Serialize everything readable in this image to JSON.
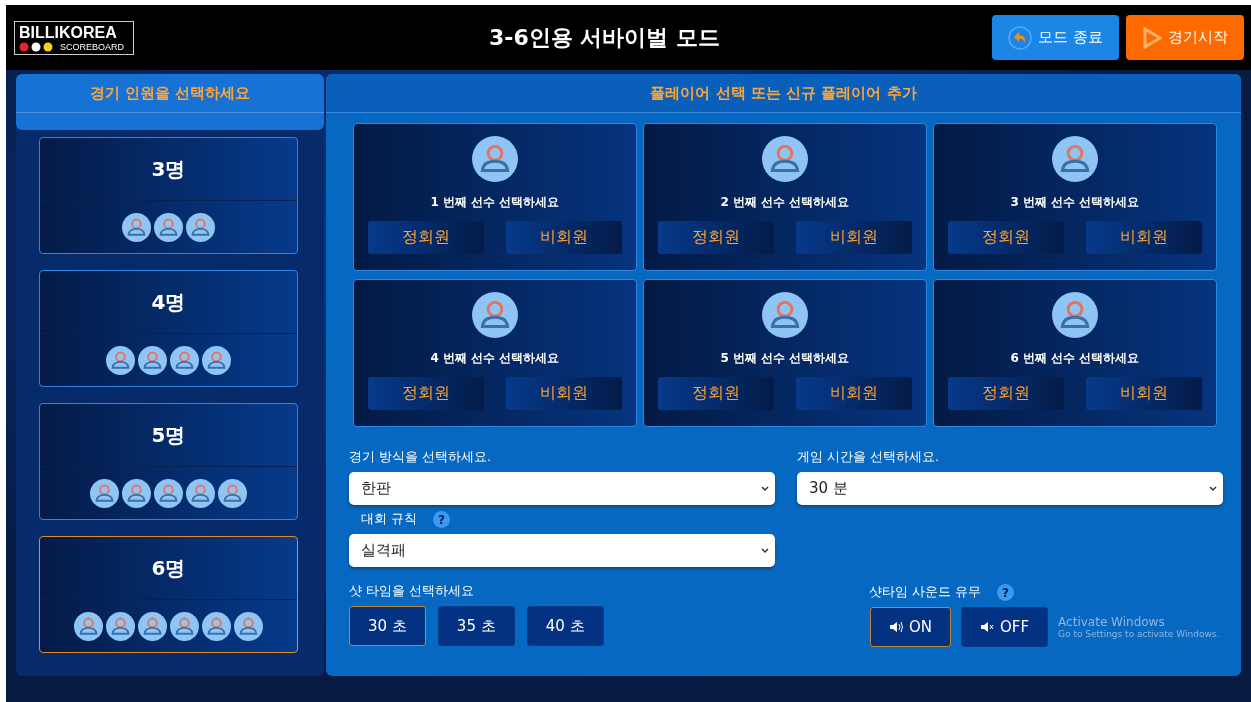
{
  "header": {
    "logo": {
      "name": "BILLIKOREA",
      "sub": "SCOREBOARD"
    },
    "title": "3-6인용 서바이벌 모드",
    "buttons": [
      {
        "kind": "exit",
        "label": "모드 종료"
      },
      {
        "kind": "start",
        "label": "경기시작"
      }
    ]
  },
  "count_panel": {
    "title": "경기 인원을 선택하세요",
    "options": [
      {
        "label": "3명",
        "selected": false
      },
      {
        "label": "4명",
        "selected": false
      },
      {
        "label": "5명",
        "selected": false
      },
      {
        "label": "6명",
        "selected": true
      }
    ]
  },
  "player_panel": {
    "title": "플레이어 선택 또는 신규 플레이어 추가",
    "slots": [
      {
        "prompt": "1 번째 선수 선택하세요",
        "buttons": [
          "정회원",
          "비회원"
        ]
      },
      {
        "prompt": "2 번째 선수 선택하세요",
        "buttons": [
          "정회원",
          "비회원"
        ]
      },
      {
        "prompt": "3 번째 선수 선택하세요",
        "buttons": [
          "정회원",
          "비회원"
        ]
      },
      {
        "prompt": "4 번째 선수 선택하세요",
        "buttons": [
          "정회원",
          "비회원"
        ]
      },
      {
        "prompt": "5 번째 선수 선택하세요",
        "buttons": [
          "정회원",
          "비회원"
        ]
      },
      {
        "prompt": "6 번째 선수 선택하세요",
        "buttons": [
          "정회원",
          "비회원"
        ]
      }
    ],
    "game_type": {
      "label": "경기 방식을 선택하세요.",
      "value": "한판"
    },
    "game_time": {
      "label": "게임 시간을 선택하세요.",
      "value": "30 분"
    },
    "rules": {
      "label": "대회 규칙",
      "help": "?",
      "value": "실격패"
    },
    "shot_time": {
      "label": "샷 타임을 선택하세요",
      "options": [
        {
          "label": "30 초",
          "selected": true
        },
        {
          "label": "35 초",
          "selected": false
        },
        {
          "label": "40 초",
          "selected": false
        }
      ]
    },
    "shot_sound": {
      "label": "샷타임 사운드 유무",
      "help": "?",
      "options": [
        {
          "kind": "on",
          "label": "ON",
          "selected": true
        },
        {
          "kind": "off",
          "label": "OFF",
          "selected": false
        }
      ]
    }
  },
  "os_notice": {
    "title": "Activate Windows",
    "text": "Go to Settings to activate Windows."
  }
}
